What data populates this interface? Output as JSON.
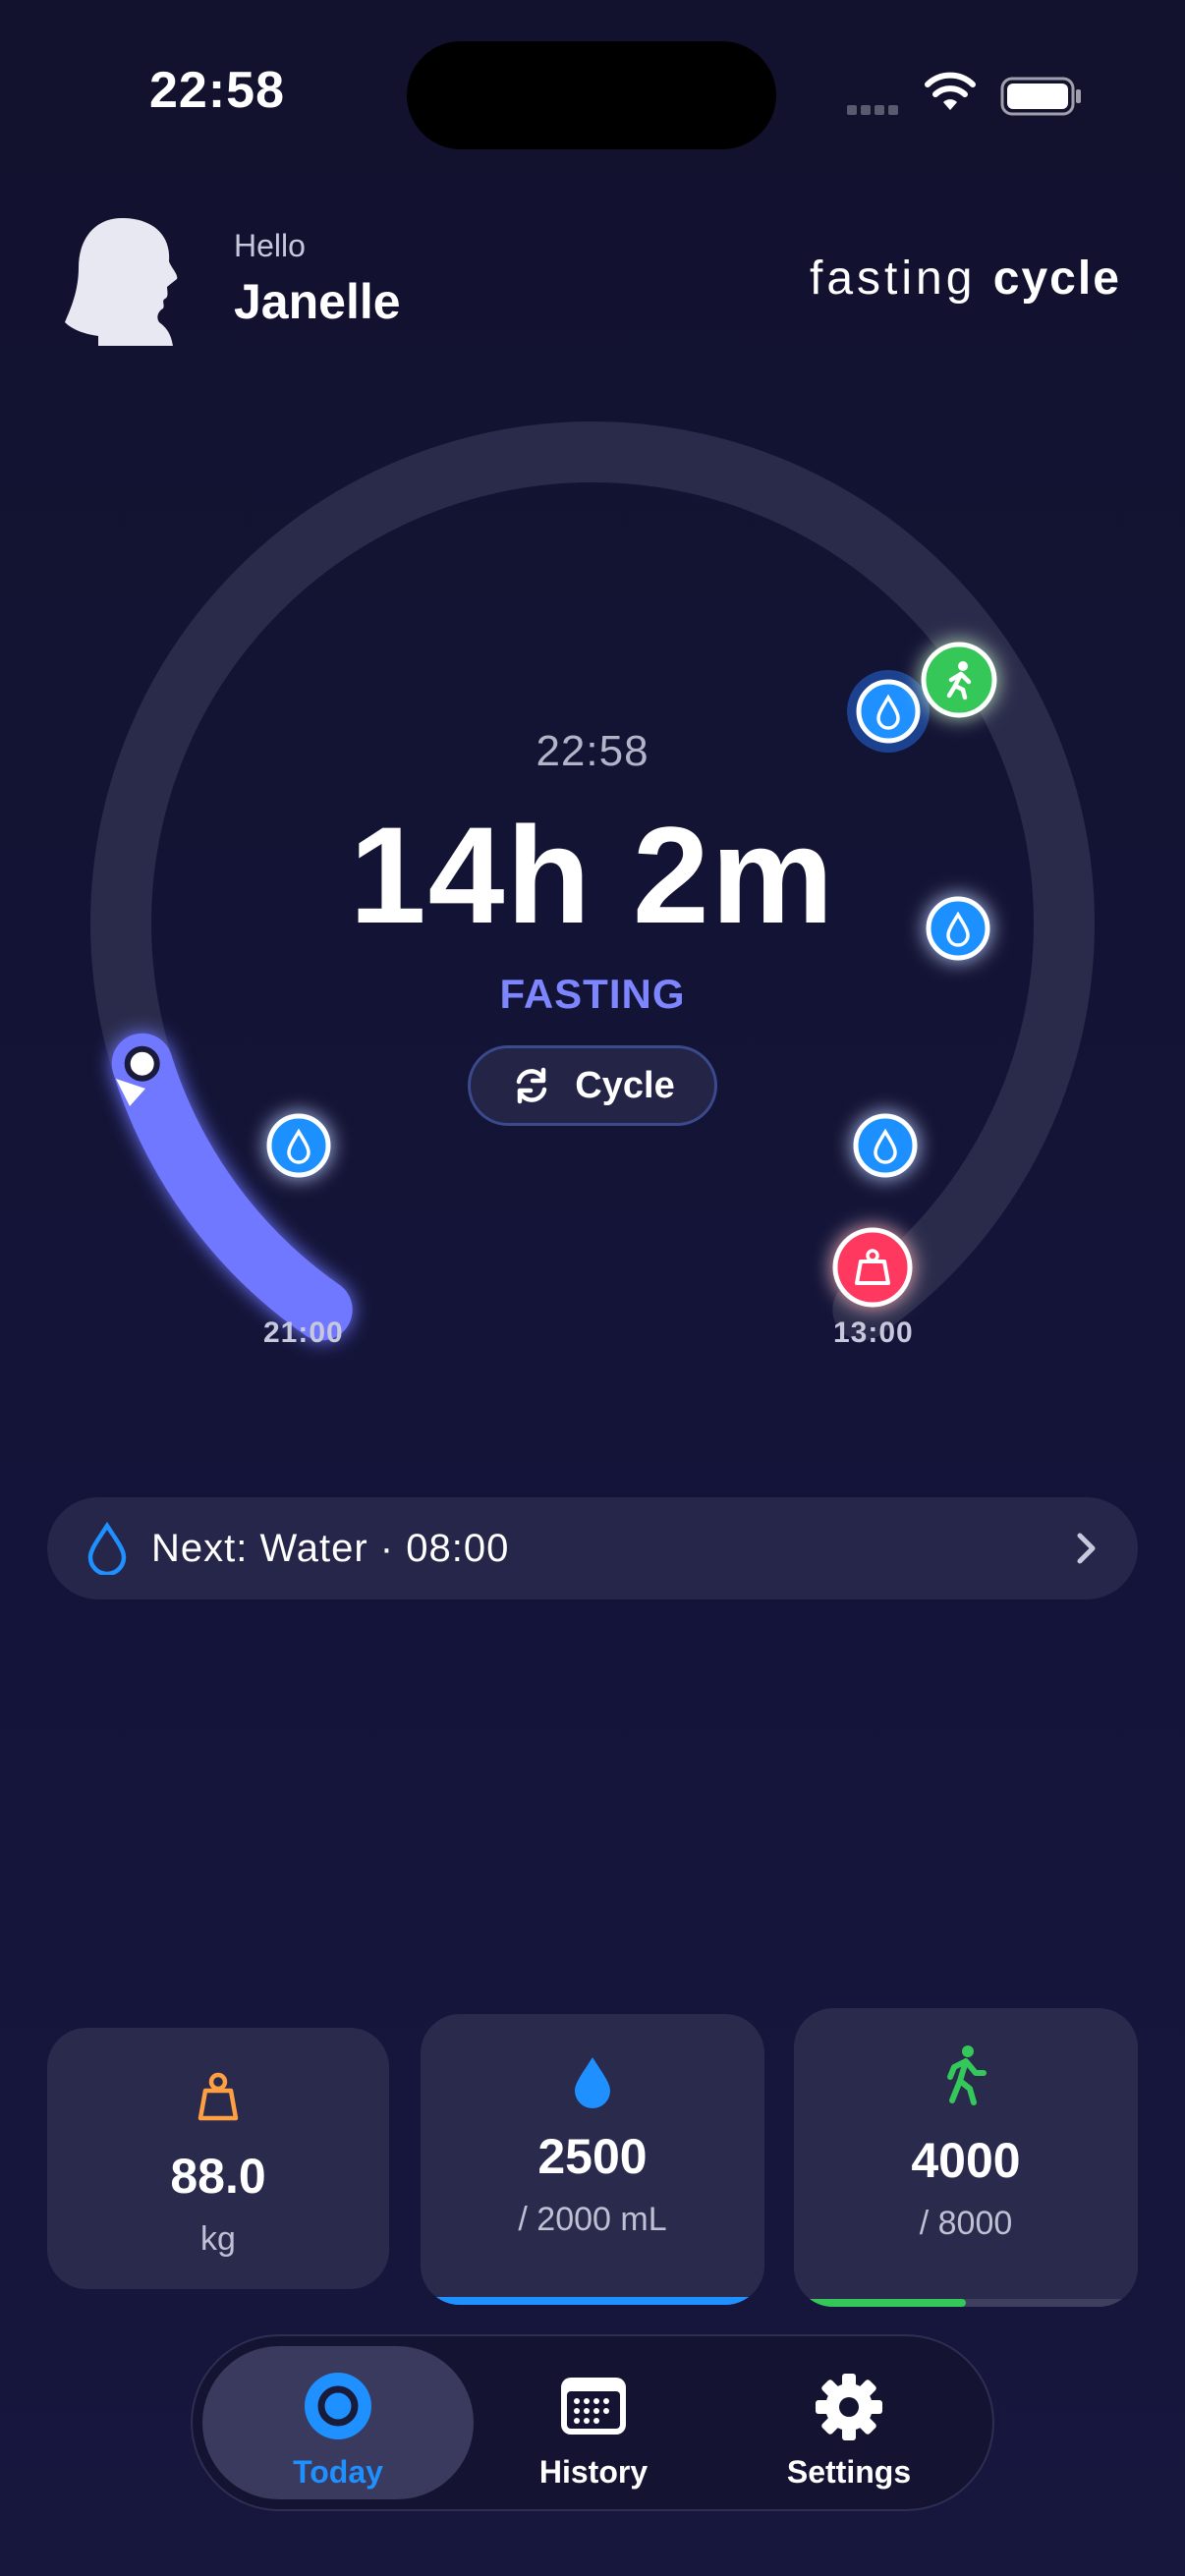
{
  "status_bar": {
    "time": "22:58"
  },
  "header": {
    "greeting": "Hello",
    "user_name": "Janelle",
    "brand_light": "fasting",
    "brand_bold": "cycle"
  },
  "dial": {
    "current_time": "22:58",
    "elapsed": "14h 2m",
    "state": "FASTING",
    "mode_button": "Cycle",
    "start_label": "21:00",
    "end_label": "13:00",
    "progress_fraction": 0.13
  },
  "next_event": {
    "text": "Next: Water · 08:00"
  },
  "stats": {
    "weight": {
      "value": "88.0",
      "unit": "kg"
    },
    "water": {
      "value": "2500",
      "goal": "/ 2000 mL",
      "progress": 1.0
    },
    "steps": {
      "value": "4000",
      "goal": "/ 8000",
      "progress": 0.5
    }
  },
  "tabs": [
    {
      "label": "Today",
      "active": true
    },
    {
      "label": "History",
      "active": false
    },
    {
      "label": "Settings",
      "active": false
    }
  ],
  "colors": {
    "accent": "#7d86ff",
    "water": "#1e90ff",
    "steps": "#34c759",
    "weight": "#ff9f43",
    "weight_marker": "#ff375f"
  }
}
